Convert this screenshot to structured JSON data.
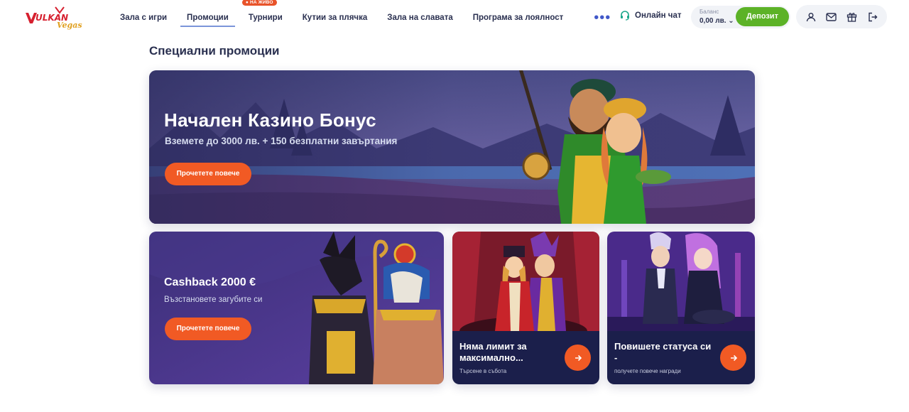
{
  "header": {
    "logo_text": "VULKAN Vegas",
    "nav": [
      {
        "label": "Зала с игри"
      },
      {
        "label": "Промоции"
      },
      {
        "label": "Турнири",
        "badge": "● НА ЖИВО"
      },
      {
        "label": "Кутии за плячка"
      },
      {
        "label": "Зала на славата"
      },
      {
        "label": "Програма за лоялност"
      }
    ],
    "more": "•••",
    "chat_label": "Онлайн чат",
    "balance_label": "Баланс",
    "balance_value": "0,00 лв. ⌄",
    "deposit_label": "Депозит",
    "icons": [
      "user-icon",
      "mail-icon",
      "gift-icon",
      "logout-icon"
    ]
  },
  "main": {
    "title": "Специални промоции",
    "hero": {
      "title": "Начален Казино Бонус",
      "subtitle": "Вземете до 3000 лв. + 150 безплатни завъртания",
      "button": "Прочетете повече"
    },
    "cashback": {
      "title": "Cashback 2000 €",
      "subtitle": "Възстановете загубите си",
      "button": "Прочетете повече"
    },
    "promo3": {
      "title": "Няма лимит за максимално...",
      "subtitle": "Търсене в събота"
    },
    "promo4": {
      "title": "Повишете статуса си -",
      "subtitle": "получете повече награди"
    }
  },
  "colors": {
    "accent_orange": "#f15a24",
    "deposit_green": "#5cb227",
    "nav_text": "#2a3050",
    "card_dark": "#1b1f4b"
  }
}
